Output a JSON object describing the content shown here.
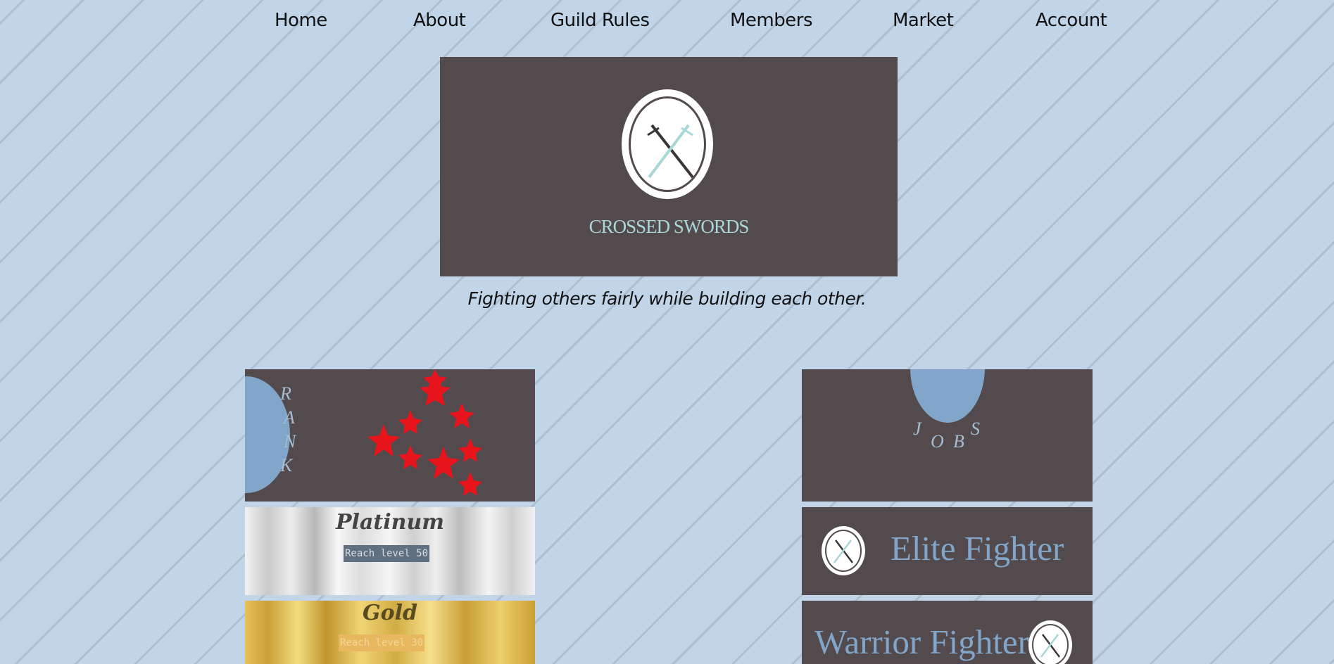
{
  "nav": {
    "items": [
      "Home",
      "About",
      "Guild Rules",
      "Members",
      "Market",
      "Account"
    ]
  },
  "hero": {
    "title": "CROSSED SWORDS",
    "icon": "crossed-swords-emblem"
  },
  "tagline": "Fighting others fairly while building each other.",
  "rank_card": {
    "letters": [
      "R",
      "A",
      "N",
      "K"
    ],
    "stars_color": "#e8141c"
  },
  "jobs_card": {
    "letters": [
      "J",
      "O",
      "B",
      "S"
    ]
  },
  "tiers": [
    {
      "name": "Platinum",
      "requirement": "Reach level 50"
    },
    {
      "name": "Gold",
      "requirement": "Reach level 30"
    }
  ],
  "jobs": [
    {
      "name": "Elite Fighter"
    },
    {
      "name": "Warrior Fighter"
    }
  ],
  "colors": {
    "background": "#c2d5e8",
    "panel": "#524a4c",
    "accent_blue": "#82a6c9",
    "title_teal": "#a9d6d6"
  }
}
